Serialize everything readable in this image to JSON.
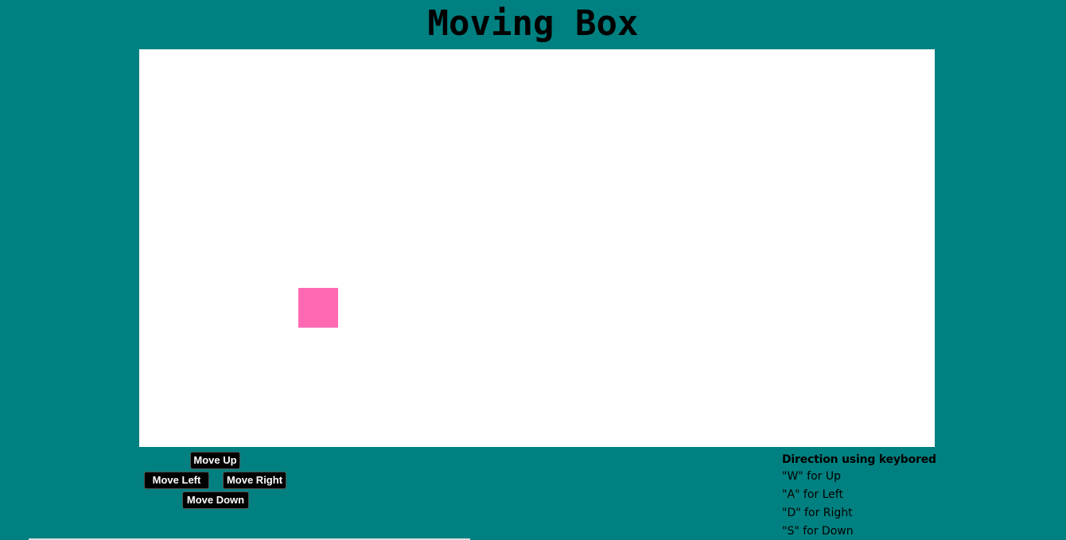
{
  "page": {
    "title": "Moving Box",
    "background_color": "#008080",
    "board_color": "#ffffff"
  },
  "box": {
    "color": "#ff69b4"
  },
  "controls": {
    "up_label": "Move Up",
    "left_label": "Move Left",
    "right_label": "Move Right",
    "down_label": "Move Down"
  },
  "help": {
    "title": "Direction using keybored",
    "lines": [
      "\"W\" for Up",
      "\"A\" for Left",
      "\"D\" for Right",
      "\"S\" for Down"
    ]
  }
}
